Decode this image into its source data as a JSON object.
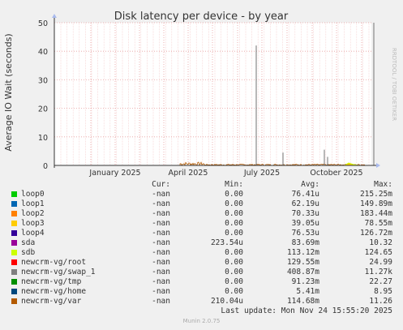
{
  "chart_data": {
    "type": "line",
    "title": "Disk latency per device - by year",
    "ylabel": "Average IO Wait (seconds)",
    "watermark": "RRDTOOL / TOBI OETIKER",
    "ylim": [
      0,
      50
    ],
    "y_ticks": [
      "0",
      "10",
      "20",
      "30",
      "40",
      "50"
    ],
    "x_tick_labels": [
      "January 2025",
      "April 2025",
      "July 2025",
      "October 2025"
    ],
    "grid": true,
    "spikes": [
      {
        "label": "July 2025",
        "offset_days": -7,
        "value": 42,
        "color": "#888888"
      },
      {
        "label": "July 2025",
        "offset_days": 26,
        "value": 4.5,
        "color": "#888888"
      },
      {
        "label": "October 2025",
        "offset_days": -15,
        "value": 5.5,
        "color": "#888888"
      },
      {
        "label": "October 2025",
        "offset_days": -11,
        "value": 3,
        "color": "#888888"
      },
      {
        "label": "October 2025",
        "offset_days": 46,
        "value": 50,
        "color": "#888888"
      }
    ],
    "noise_region": {
      "from_label": "April 2025",
      "from_offset_days": -10,
      "to_label": "October 2025",
      "to_offset_days": 35
    }
  },
  "legend": {
    "headers": {
      "cur": "Cur:",
      "min": "Min:",
      "avg": "Avg:",
      "max": "Max:"
    },
    "rows": [
      {
        "name": "loop0",
        "color": "#00cc00",
        "cur": "-nan",
        "min": "0.00",
        "avg": "76.41u",
        "max": "215.25m"
      },
      {
        "name": "loop1",
        "color": "#0066b3",
        "cur": "-nan",
        "min": "0.00",
        "avg": "62.19u",
        "max": "149.89m"
      },
      {
        "name": "loop2",
        "color": "#ff8000",
        "cur": "-nan",
        "min": "0.00",
        "avg": "70.33u",
        "max": "183.44m"
      },
      {
        "name": "loop3",
        "color": "#ffcc00",
        "cur": "-nan",
        "min": "0.00",
        "avg": "39.05u",
        "max": "78.55m"
      },
      {
        "name": "loop4",
        "color": "#330099",
        "cur": "-nan",
        "min": "0.00",
        "avg": "76.53u",
        "max": "126.72m"
      },
      {
        "name": "sda",
        "color": "#990099",
        "cur": "-nan",
        "min": "223.54u",
        "avg": "83.69m",
        "max": "10.32"
      },
      {
        "name": "sdb",
        "color": "#ccff00",
        "cur": "-nan",
        "min": "0.00",
        "avg": "113.12m",
        "max": "124.65"
      },
      {
        "name": "newcrm-vg/root",
        "color": "#ff0000",
        "cur": "-nan",
        "min": "0.00",
        "avg": "129.55m",
        "max": "24.99"
      },
      {
        "name": "newcrm-vg/swap_1",
        "color": "#808080",
        "cur": "-nan",
        "min": "0.00",
        "avg": "408.87m",
        "max": "11.27k"
      },
      {
        "name": "newcrm-vg/tmp",
        "color": "#008f00",
        "cur": "-nan",
        "min": "0.00",
        "avg": "91.23m",
        "max": "22.27"
      },
      {
        "name": "newcrm-vg/home",
        "color": "#00487d",
        "cur": "-nan",
        "min": "0.00",
        "avg": "5.41m",
        "max": "8.95"
      },
      {
        "name": "newcrm-vg/var",
        "color": "#b35a00",
        "cur": "-nan",
        "min": "210.04u",
        "avg": "114.68m",
        "max": "11.26"
      }
    ],
    "last_update": "Last update: Mon Nov 24 15:55:20 2025"
  },
  "footer": "Munin 2.0.75"
}
